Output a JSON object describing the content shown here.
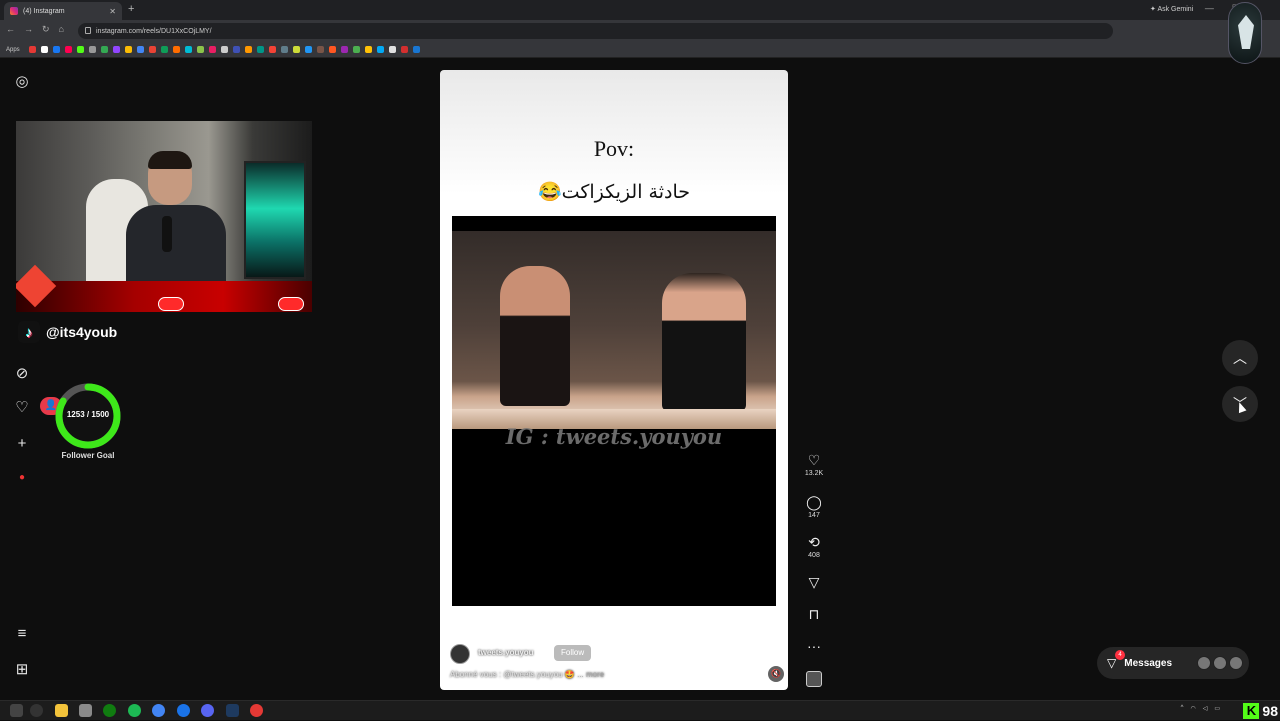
{
  "browser": {
    "tab_title": "(4) Instagram",
    "url": "instagram.com/reels/DU1XxCOjLMY/",
    "apps_label": "Apps",
    "gemini_label": "Ask Gemini"
  },
  "stream": {
    "tiktok_handle": "@its4youb",
    "follower_goal_count": "1253 / 1500",
    "follower_goal_label": "Follower Goal",
    "follower_goal_progress": 0.835
  },
  "reel": {
    "title_line1": "Pov:",
    "title_line2": "حادثة الزيكزاكت😂",
    "watermark": "IG : tweets.youyou",
    "username": "tweets.youyou",
    "follow_label": "Follow",
    "caption": "Abonné vous : @tweets.youyou 🤩",
    "caption_more": "... more"
  },
  "actions": {
    "likes": "13.2K",
    "comments": "147",
    "reposts": "408"
  },
  "messages": {
    "label": "Messages",
    "badge": "4"
  },
  "kick_count": "98",
  "colors": {
    "goal_ring": "#3ee81a",
    "badge_red": "#ff3040",
    "kick_green": "#53fc18"
  }
}
